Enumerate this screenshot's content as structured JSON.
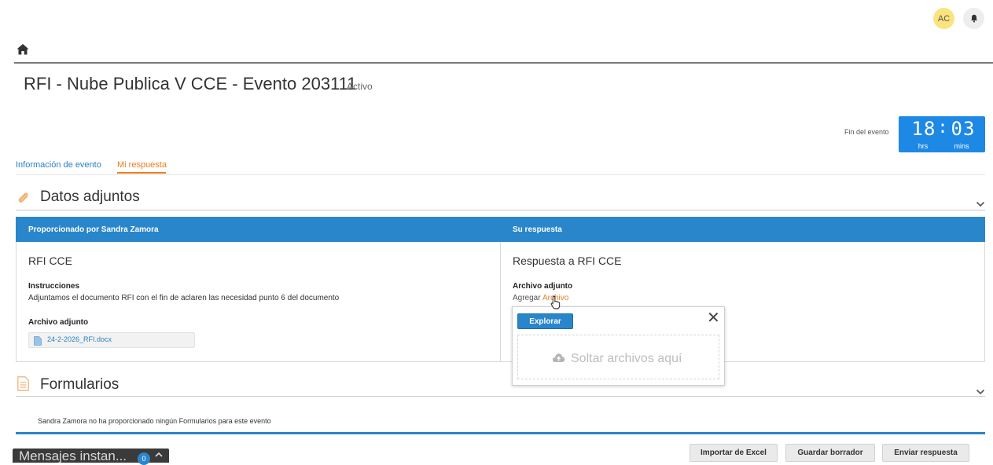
{
  "header": {
    "avatar_initials": "AC",
    "icons": {
      "home": "home-icon",
      "bell": "bell-icon"
    }
  },
  "event": {
    "title": "RFI - Nube Publica V CCE - Evento 203111",
    "status": "Activo"
  },
  "timer": {
    "label": "Fin del evento",
    "hours": "18",
    "separator": ":",
    "minutes": "03",
    "hours_label": "hrs",
    "minutes_label": "mins",
    "color": "#1e88e5"
  },
  "tabs": [
    {
      "label": "Información de evento",
      "active": false
    },
    {
      "label": "Mi respuesta",
      "active": true
    }
  ],
  "attachments_section": {
    "title": "Datos adjuntos",
    "left_header": "Proporcionado por Sandra Zamora",
    "right_header": "Su respuesta",
    "left": {
      "name": "RFI CCE",
      "instructions_label": "Instrucciones",
      "instructions_text": "Adjuntamos el documento RFI con el fin de aclaren las necesidad punto 6 del documento",
      "attachment_label": "Archivo adjunto",
      "file_name": "24-2-2026_RFI.docx"
    },
    "right": {
      "name": "Respuesta a RFI CCE",
      "attachment_label": "Archivo adjunto",
      "add_prefix": "Agregar",
      "add_link": "Archivo"
    }
  },
  "upload_popup": {
    "browse_label": "Explorar",
    "close_glyph": "✕",
    "drop_text": "Soltar archivos aquí"
  },
  "forms_section": {
    "title": "Formularios",
    "message": "Sandra Zamora no ha proporcionado ningún Formularios para este evento"
  },
  "footer": {
    "messages_label": "Mensajes instan...",
    "messages_count": "0",
    "buttons": {
      "import": "Importar de Excel",
      "save_draft": "Guardar borrador",
      "submit": "Enviar respuesta"
    }
  },
  "colors": {
    "accent_blue": "#2a86ca",
    "accent_orange": "#e77f24",
    "link_blue": "#2a7fc1"
  }
}
